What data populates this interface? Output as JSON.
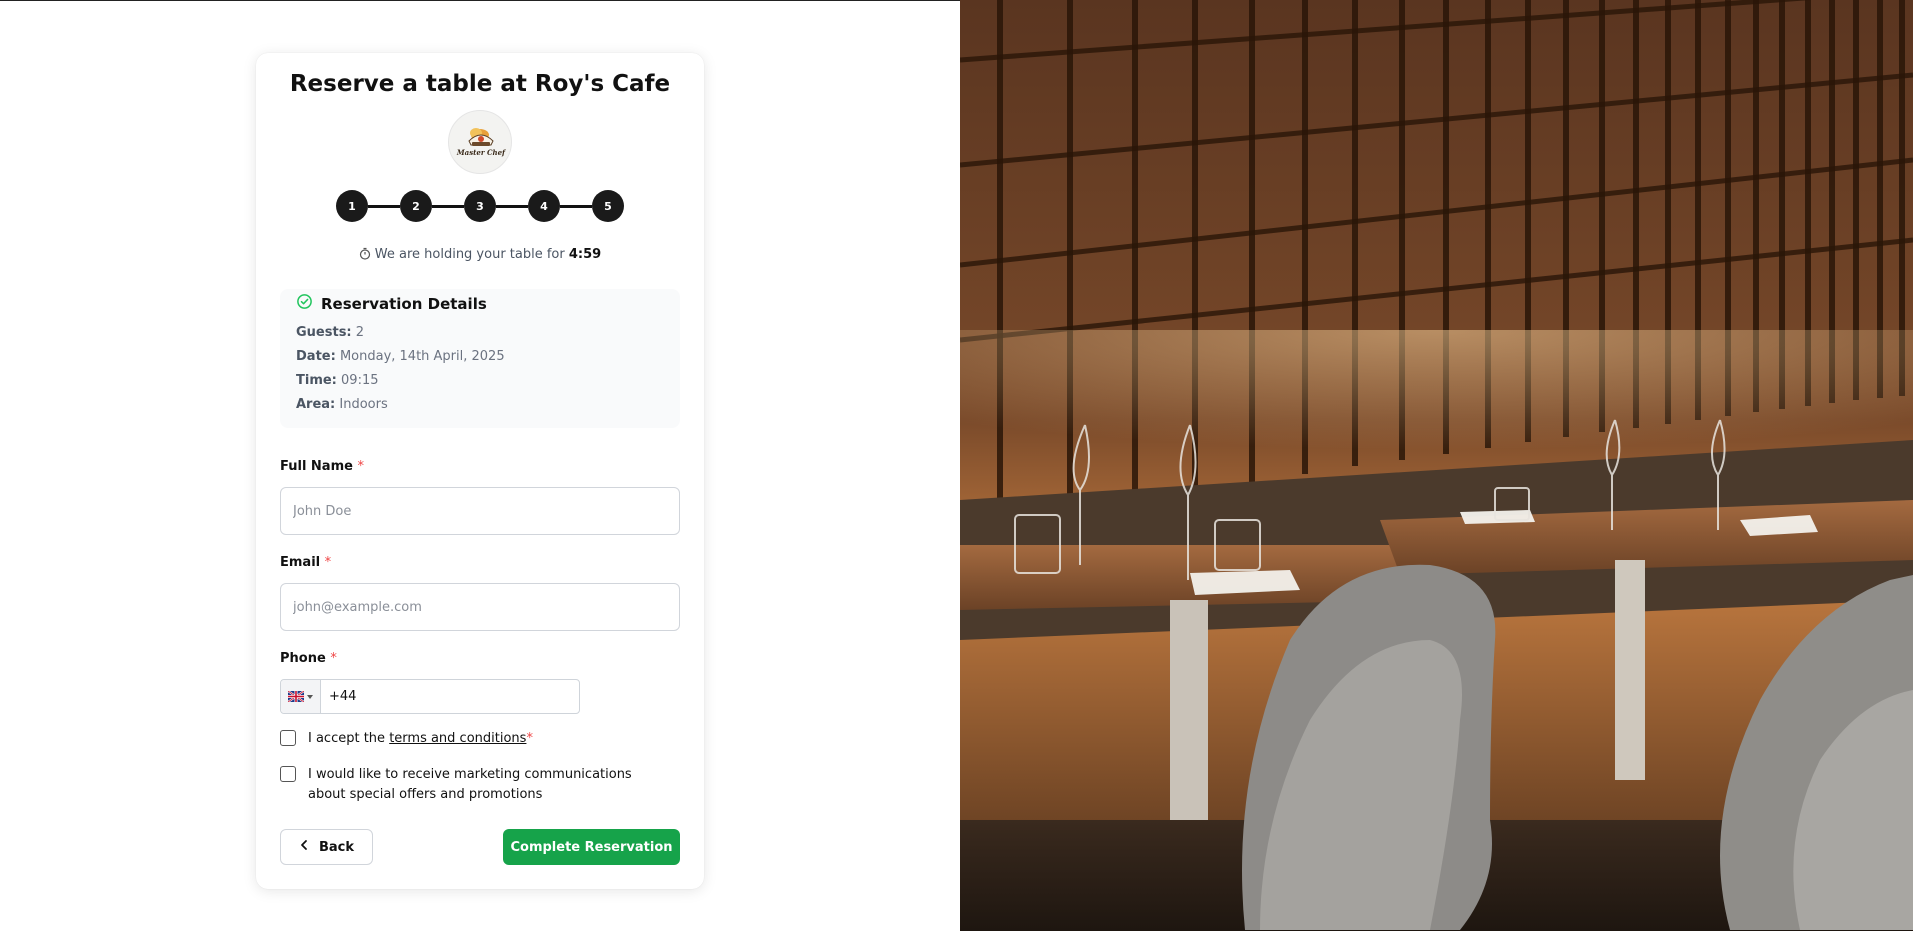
{
  "title": "Reserve a table at Roy's Cafe",
  "logo": {
    "icon": "chef-logo-icon",
    "text": "Master Chef"
  },
  "steps": [
    "1",
    "2",
    "3",
    "4",
    "5"
  ],
  "hold": {
    "prefix": "We are holding your table for",
    "time": "4:59"
  },
  "details": {
    "title": "Reservation Details",
    "rows": [
      {
        "label": "Guests:",
        "value": "2"
      },
      {
        "label": "Date:",
        "value": "Monday, 14th April, 2025"
      },
      {
        "label": "Time:",
        "value": "09:15"
      },
      {
        "label": "Area:",
        "value": "Indoors"
      }
    ]
  },
  "form": {
    "full_name": {
      "label": "Full Name",
      "required": "*",
      "placeholder": "John Doe",
      "value": ""
    },
    "email": {
      "label": "Email",
      "required": "*",
      "placeholder": "john@example.com",
      "value": ""
    },
    "phone": {
      "label": "Phone",
      "required": "*",
      "value": "+44",
      "country_flag": "uk-flag-icon"
    }
  },
  "checkboxes": {
    "terms": {
      "prefix": "I accept the ",
      "link": "terms and conditions",
      "required": "*",
      "checked": false
    },
    "marketing": {
      "text": "I would like to receive marketing communications about special offers and promotions",
      "checked": false
    }
  },
  "buttons": {
    "back": "Back",
    "complete": "Complete Reservation"
  },
  "colors": {
    "primary": "#16a34a",
    "step": "#1a1a1a",
    "required": "#ef4444",
    "accent_check": "#22c55e"
  }
}
